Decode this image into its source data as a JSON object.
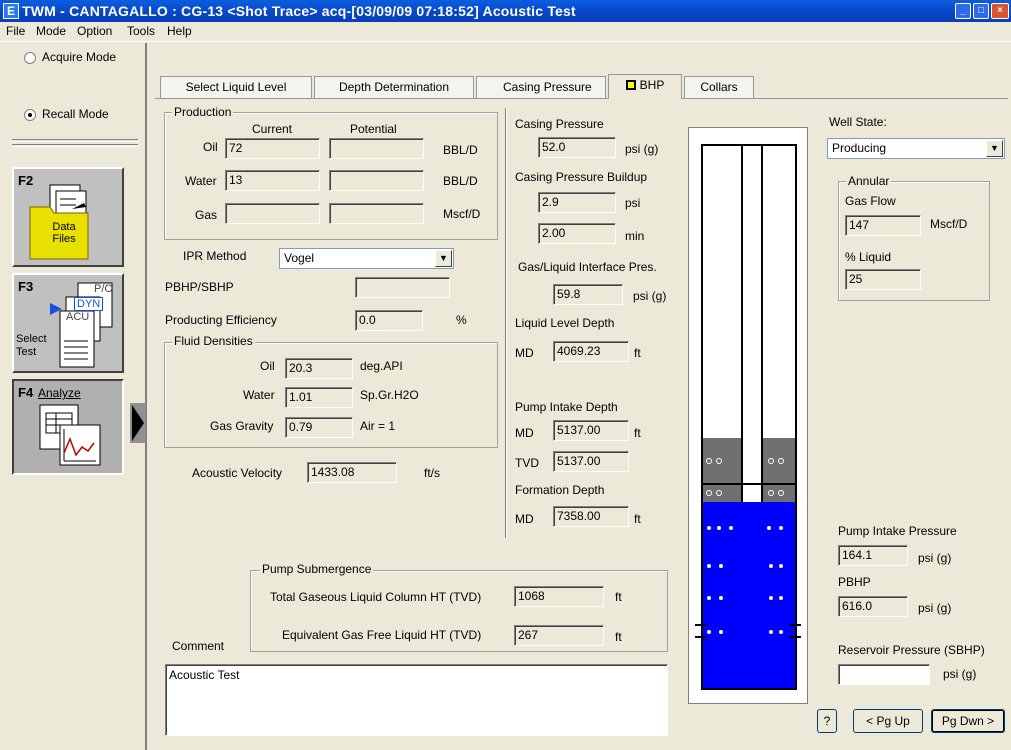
{
  "window": {
    "title": "TWM  -  CANTAGALLO : CG-13  <Shot Trace>  acq-[03/09/09 07:18:52]  Acoustic Test",
    "icon": "app-icon"
  },
  "menu": [
    "File",
    "Mode",
    "Option",
    "Tools",
    "Help"
  ],
  "sidebar": {
    "acquire_mode": "Acquire Mode",
    "recall_mode": "Recall Mode",
    "f2_key": "F2",
    "f2_label": "Data Files",
    "f3_key": "F3",
    "f3_label": "Select Test",
    "f3_doc_labels": [
      "P/C",
      "DYN",
      "ACU"
    ],
    "f4_key": "F4",
    "f4_label": "Analyze"
  },
  "tabs": [
    "Select Liquid Level",
    "Depth Determination",
    "Casing Pressure",
    "BHP",
    "Collars"
  ],
  "production": {
    "title": "Production",
    "col_current": "Current",
    "col_potential": "Potential",
    "rows": [
      {
        "label": "Oil",
        "current": "72",
        "potential": "",
        "unit": "BBL/D"
      },
      {
        "label": "Water",
        "current": "13",
        "potential": "",
        "unit": "BBL/D"
      },
      {
        "label": "Gas",
        "current": "",
        "potential": "",
        "unit": "Mscf/D"
      }
    ]
  },
  "ipr": {
    "method_label": "IPR Method",
    "method_value": "Vogel",
    "pbhp_label": "PBHP/SBHP",
    "pbhp_value": "",
    "efficiency_label": "Producting Efficiency",
    "efficiency_value": "0.0",
    "efficiency_unit": "%"
  },
  "fluid": {
    "title": "Fluid Densities",
    "oil_label": "Oil",
    "oil_value": "20.3",
    "oil_unit": "deg.API",
    "water_label": "Water",
    "water_value": "1.01",
    "water_unit": "Sp.Gr.H2O",
    "gas_label": "Gas Gravity",
    "gas_value": "0.79",
    "gas_unit": "Air = 1"
  },
  "acoustic": {
    "label": "Acoustic Velocity",
    "value": "1433.08",
    "unit": "ft/s"
  },
  "middle": {
    "casing_pressure_label": "Casing Pressure",
    "casing_pressure_value": "52.0",
    "casing_pressure_unit": "psi (g)",
    "buildup_label": "Casing Pressure Buildup",
    "buildup_psi": "2.9",
    "buildup_psi_unit": "psi",
    "buildup_min": "2.00",
    "buildup_min_unit": "min",
    "interface_label": "Gas/Liquid Interface Pres.",
    "interface_value": "59.8",
    "interface_unit": "psi (g)",
    "lld_label": "Liquid Level Depth",
    "lld_prefix": "MD",
    "lld_value": "4069.23",
    "lld_unit": "ft",
    "pid_label": "Pump Intake Depth",
    "pid_md_prefix": "MD",
    "pid_md_value": "5137.00",
    "pid_md_unit": "ft",
    "pid_tvd_prefix": "TVD",
    "pid_tvd_value": "5137.00",
    "fd_label": "Formation Depth",
    "fd_prefix": "MD",
    "fd_value": "7358.00",
    "fd_unit": "ft"
  },
  "submergence": {
    "title": "Pump Submergence",
    "gaseous_label": "Total Gaseous Liquid Column HT  (TVD)",
    "gaseous_value": "1068",
    "gaseous_unit": "ft",
    "gasfree_label": "Equivalent Gas Free Liquid HT  (TVD)",
    "gasfree_value": "267",
    "gasfree_unit": "ft"
  },
  "comment": {
    "label": "Comment",
    "value": "Acoustic Test"
  },
  "right": {
    "well_state_label": "Well State:",
    "well_state_value": "Producing",
    "annular_title": "Annular",
    "gas_flow_label": "Gas Flow",
    "gas_flow_value": "147",
    "gas_flow_unit": "Mscf/D",
    "liquid_label": "% Liquid",
    "liquid_value": "25",
    "pip_label": "Pump Intake Pressure",
    "pip_value": "164.1",
    "pip_unit": "psi (g)",
    "pbhp_label": "PBHP",
    "pbhp_value": "616.0",
    "pbhp_unit": "psi (g)",
    "sbhp_label": "Reservoir Pressure (SBHP)",
    "sbhp_value": "",
    "sbhp_unit": "psi (g)"
  },
  "buttons": {
    "help": "?",
    "pgup": "< Pg Up",
    "pgdn": "Pg Dwn >"
  },
  "colors": {
    "liquid": "#0000FF",
    "gas_column": "#707070",
    "titlebar": "#0A50D8"
  }
}
